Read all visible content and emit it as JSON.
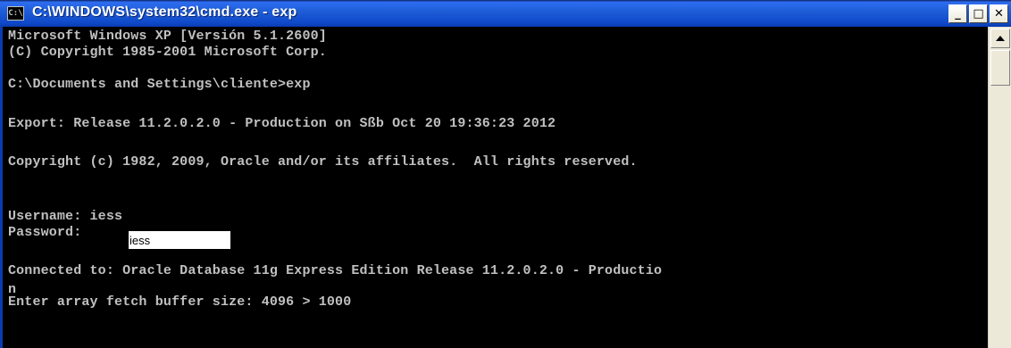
{
  "window": {
    "title": "C:\\WINDOWS\\system32\\cmd.exe - exp",
    "icon_label": "C:\\",
    "minimize_glyph": "_",
    "maximize_glyph": "□",
    "close_glyph": "✕"
  },
  "console": {
    "lines": [
      "Microsoft Windows XP [Versión 5.1.2600]",
      "(C) Copyright 1985-2001 Microsoft Corp.",
      "C:\\Documents and Settings\\cliente>exp",
      "Export: Release 11.2.0.2.0 - Production on Sßb Oct 20 19:36:23 2012",
      "Copyright (c) 1982, 2009, Oracle and/or its affiliates.  All rights reserved.",
      "Username: iess",
      "Password:",
      "Connected to: Oracle Database 11g Express Edition Release 11.2.0.2.0 - Productio",
      "n",
      "Enter array fetch buffer size: 4096 > 1000"
    ],
    "password_value": "iess"
  },
  "icons": {
    "app": "cmd-icon",
    "minimize": "minimize-icon",
    "maximize": "maximize-icon",
    "close": "close-icon",
    "scroll_up": "arrow-up-icon"
  }
}
